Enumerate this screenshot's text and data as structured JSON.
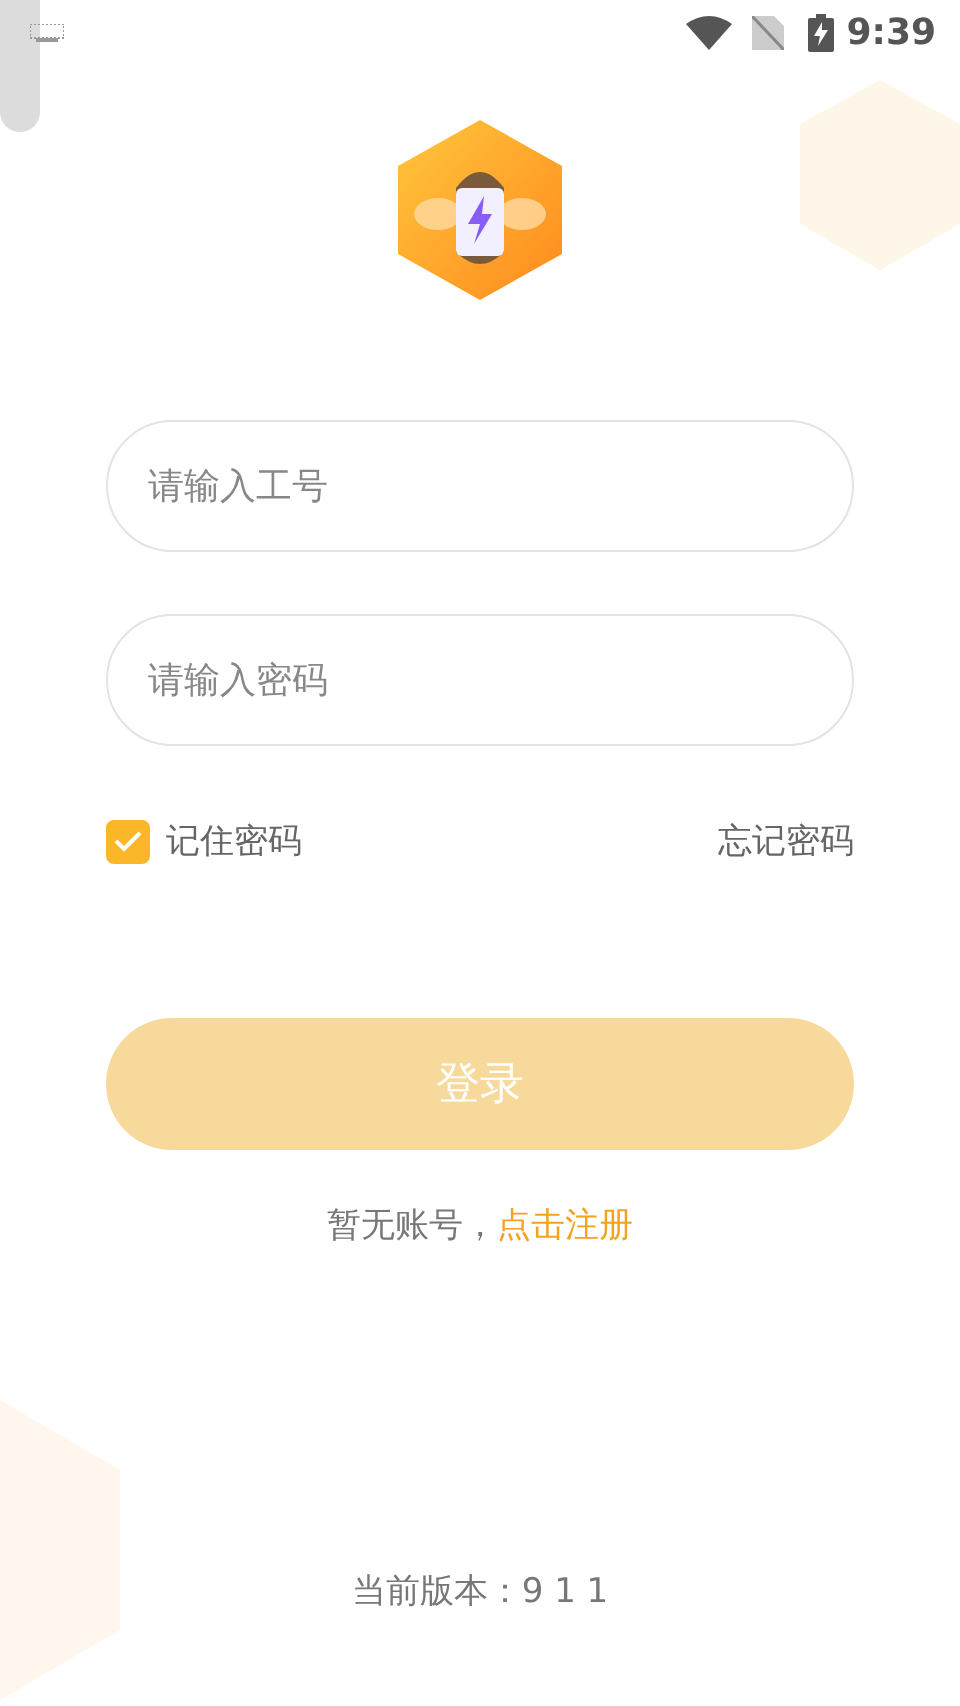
{
  "status_bar": {
    "time": "9:39"
  },
  "username_field": {
    "placeholder": "请输入工号"
  },
  "password_field": {
    "placeholder": "请输入密码"
  },
  "remember": {
    "label": "记住密码",
    "checked": true
  },
  "forgot_link": "忘记密码",
  "login_button": {
    "label": "登录",
    "disabled": true
  },
  "register": {
    "prompt": "暂无账号，",
    "link": "点击注册"
  },
  "version": "当前版本：9 1 1"
}
